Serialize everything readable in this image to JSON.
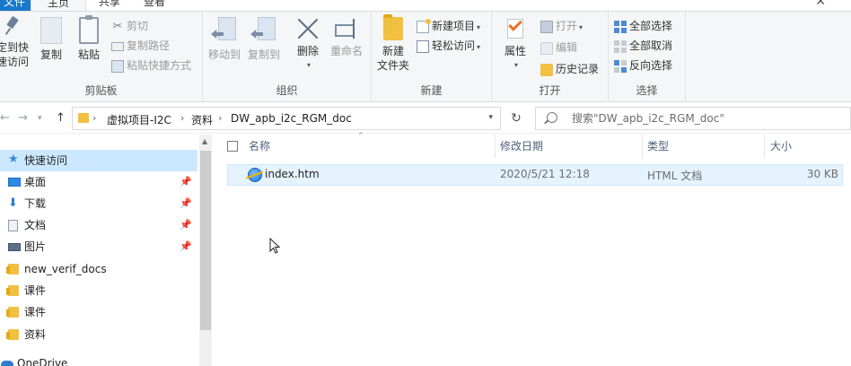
{
  "tabs": {
    "file": "文件",
    "home": "主页",
    "share": "共享",
    "view": "查看"
  },
  "ribbon": {
    "clipboard": {
      "pin_label_line1": "定到快",
      "pin_label_line2": "速访问",
      "copy": "复制",
      "paste": "粘贴",
      "cut": "剪切",
      "copy_path": "复制路径",
      "paste_shortcut": "粘贴快捷方式",
      "group_label": "剪贴板"
    },
    "organize": {
      "move_to": "移动到",
      "copy_to": "复制到",
      "delete": "删除",
      "rename": "重命名",
      "group_label": "组织"
    },
    "new": {
      "new_folder_line1": "新建",
      "new_folder_line2": "文件夹",
      "new_item": "新建项目",
      "easy_access": "轻松访问",
      "group_label": "新建"
    },
    "open": {
      "properties": "属性",
      "open": "打开",
      "edit": "编辑",
      "history": "历史记录",
      "group_label": "打开"
    },
    "select": {
      "select_all": "全部选择",
      "select_none": "全部取消",
      "invert": "反向选择",
      "group_label": "选择"
    }
  },
  "address": {
    "crumb_root": "虚拟项目-I2C",
    "crumb_mid": "资料",
    "crumb_current": "DW_apb_i2c_RGM_doc",
    "search_placeholder": "搜索\"DW_apb_i2c_RGM_doc\""
  },
  "nav": {
    "items": [
      {
        "label": "快速访问",
        "icon": "star-icon"
      },
      {
        "label": "桌面",
        "icon": "desktop-icon"
      },
      {
        "label": "下载",
        "icon": "download-icon"
      },
      {
        "label": "文档",
        "icon": "documents-icon"
      },
      {
        "label": "图片",
        "icon": "pictures-icon"
      },
      {
        "label": "new_verif_docs",
        "icon": "folder-icon"
      },
      {
        "label": "课件",
        "icon": "folder-icon"
      },
      {
        "label": "课件",
        "icon": "folder-icon"
      },
      {
        "label": "资料",
        "icon": "folder-icon"
      },
      {
        "label": "OneDrive",
        "icon": "onedrive-icon"
      }
    ]
  },
  "columns": {
    "name": "名称",
    "modified": "修改日期",
    "type": "类型",
    "size": "大小"
  },
  "files": [
    {
      "name": "index.htm",
      "modified": "2020/5/21 12:18",
      "type": "HTML 文档",
      "size": "30 KB"
    }
  ],
  "colors": {
    "accent": "#1979ca",
    "selected_row": "#e5f3ff",
    "nav_active": "#cce8ff"
  }
}
